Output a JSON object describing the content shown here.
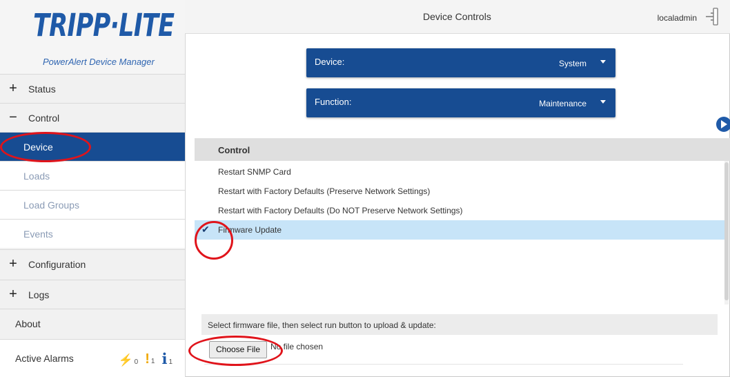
{
  "brand": {
    "logo_text": "TRIPP·LITE",
    "subtitle": "PowerAlert Device Manager"
  },
  "sidebar": {
    "items": [
      {
        "sign": "+",
        "label": "Status"
      },
      {
        "sign": "−",
        "label": "Control"
      },
      {
        "label": "Device",
        "active": true
      },
      {
        "label": "Loads"
      },
      {
        "label": "Load Groups"
      },
      {
        "label": "Events"
      },
      {
        "sign": "+",
        "label": "Configuration"
      },
      {
        "sign": "+",
        "label": "Logs"
      },
      {
        "label": "About"
      }
    ],
    "alarms": {
      "label": "Active Alarms",
      "critical_symbol": "⚡",
      "critical_count": "0",
      "warning_symbol": "!",
      "warning_count": "1",
      "info_symbol": "i",
      "info_count": "1"
    }
  },
  "header": {
    "title": "Device Controls",
    "user": "localadmin"
  },
  "dropdowns": {
    "device": {
      "label": "Device:",
      "value": "System"
    },
    "function": {
      "label": "Function:",
      "value": "Maintenance"
    }
  },
  "control_table": {
    "header": "Control",
    "rows": [
      {
        "label": "Restart SNMP Card",
        "selected": false
      },
      {
        "label": "Restart with Factory Defaults (Preserve Network Settings)",
        "selected": false
      },
      {
        "label": "Restart with Factory Defaults (Do NOT Preserve Network Settings)",
        "selected": false
      },
      {
        "label": "Firmware Update",
        "selected": true
      }
    ]
  },
  "file_upload": {
    "instruction": "Select firmware file, then select run button to upload & update:",
    "button_label": "Choose File",
    "status": "No file chosen"
  },
  "colors": {
    "primary": "#174c92",
    "selected_row": "#c7e4f8",
    "annotation": "#e0141b",
    "critical": "#e0141b",
    "warning": "#f0a800",
    "info": "#1f5aa8"
  },
  "icons": [
    "plug-icon",
    "play-circle-icon",
    "checkmark-icon",
    "caret-down-icon",
    "lightning-icon",
    "exclamation-icon",
    "info-icon"
  ]
}
